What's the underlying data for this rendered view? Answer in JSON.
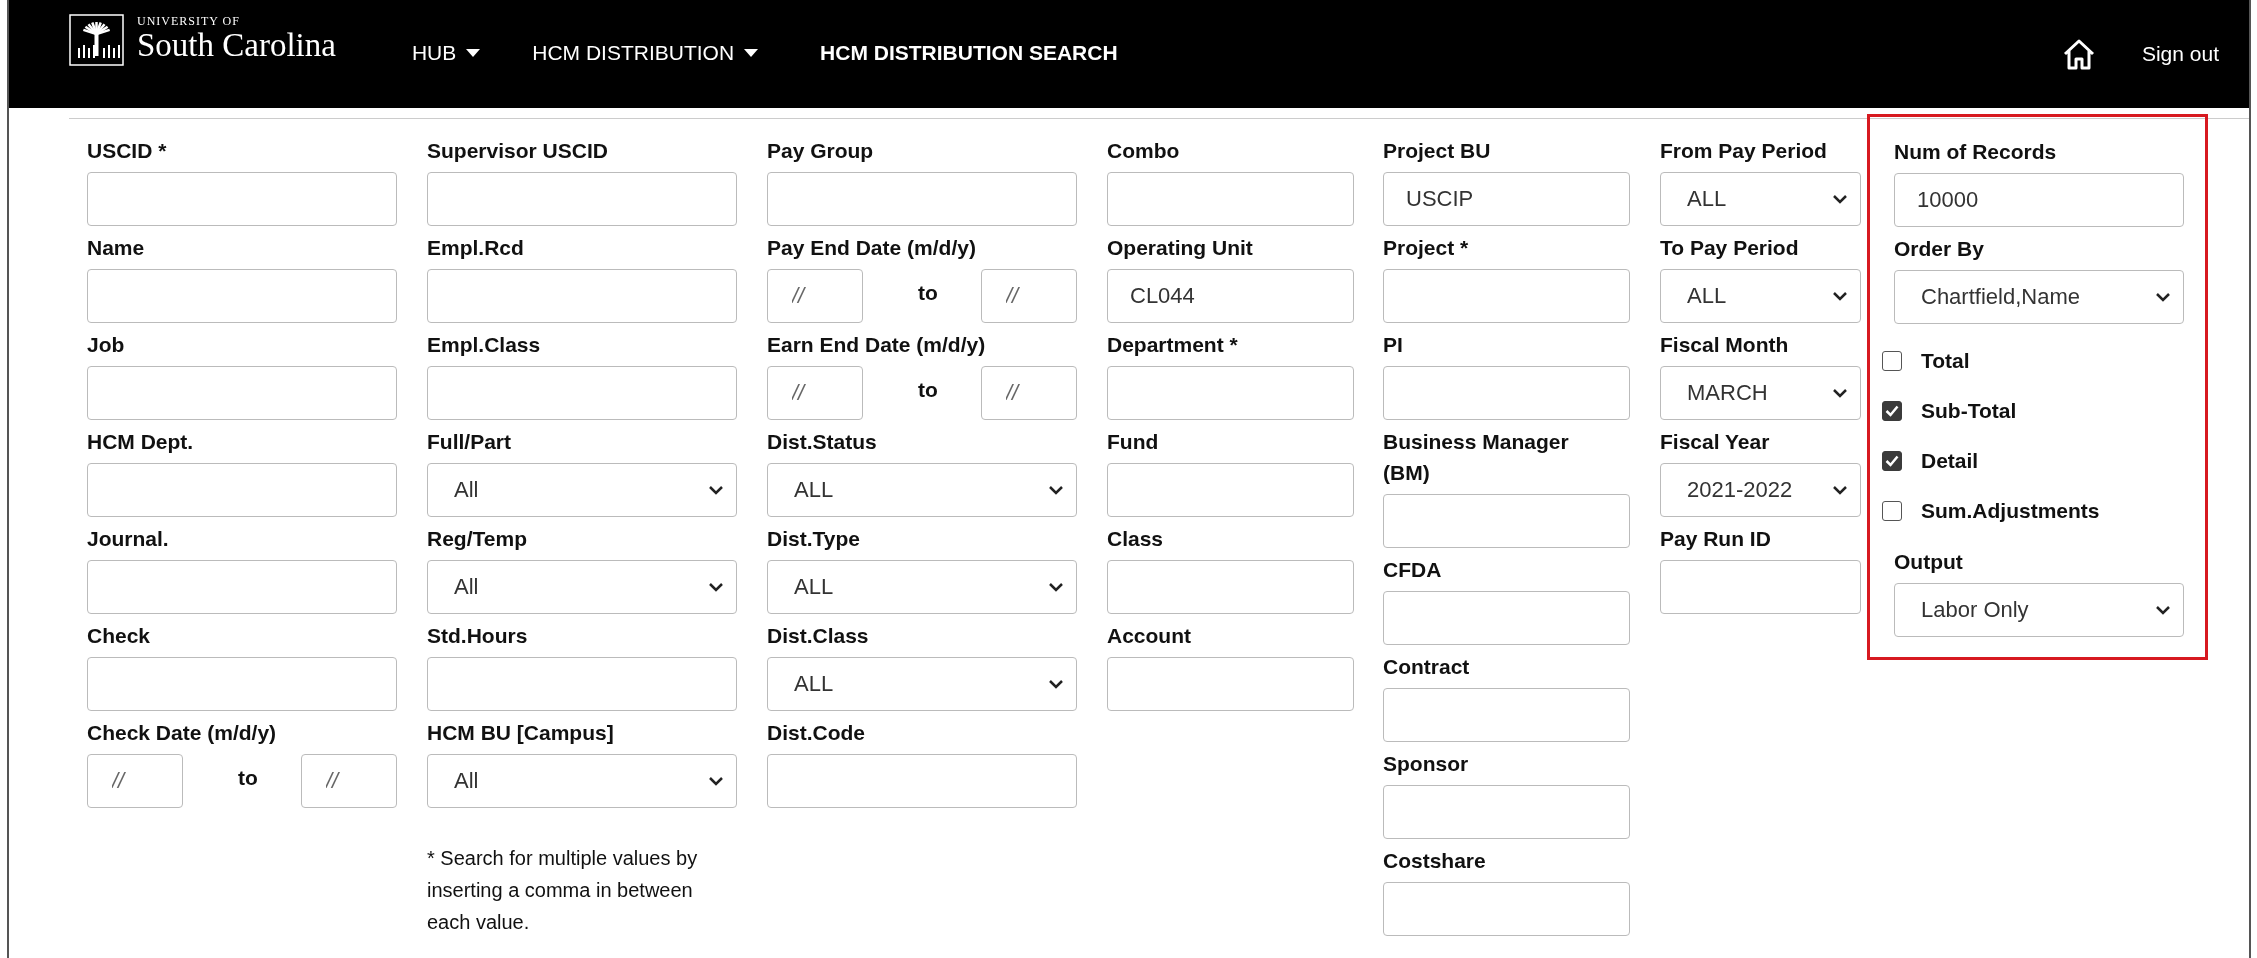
{
  "header": {
    "logo": {
      "line_1": "UNIVERSITY OF",
      "line_2": "South Carolina"
    },
    "nav": [
      {
        "label": "HUB",
        "kind": "dropdown",
        "selected": false
      },
      {
        "label": "HCM DISTRIBUTION",
        "kind": "dropdown",
        "selected": false
      },
      {
        "label": "HCM DISTRIBUTION SEARCH",
        "kind": "link",
        "selected": true
      }
    ],
    "sign_out": "Sign out"
  },
  "form": {
    "columns": [
      {
        "highlighted": false,
        "fields": [
          {
            "kind": "text",
            "label": "USCID *"
          },
          {
            "kind": "text",
            "label": "Name"
          },
          {
            "kind": "text",
            "label": "Job"
          },
          {
            "kind": "text",
            "label": "HCM Dept."
          },
          {
            "kind": "text",
            "label": "Journal."
          },
          {
            "kind": "text",
            "label": "Check"
          },
          {
            "kind": "date_range",
            "label": "Check Date (m/d/y)",
            "from_placeholder": "//",
            "joiner": "to",
            "to_placeholder": "//"
          }
        ]
      },
      {
        "highlighted": false,
        "fields": [
          {
            "kind": "text",
            "label": "Supervisor USCID"
          },
          {
            "kind": "text",
            "label": "Empl.Rcd"
          },
          {
            "kind": "text",
            "label": "Empl.Class"
          },
          {
            "kind": "select",
            "label": "Full/Part",
            "value": "All"
          },
          {
            "kind": "select",
            "label": "Reg/Temp",
            "value": "All"
          },
          {
            "kind": "text",
            "label": "Std.Hours"
          },
          {
            "kind": "select",
            "label": "HCM BU [Campus]",
            "value": "All"
          },
          {
            "kind": "note",
            "text": "* Search for multiple values by inserting a comma in between each value."
          }
        ]
      },
      {
        "highlighted": false,
        "fields": [
          {
            "kind": "text",
            "label": "Pay Group"
          },
          {
            "kind": "date_range",
            "label": "Pay End Date (m/d/y)",
            "from_placeholder": "//",
            "joiner": "to",
            "to_placeholder": "//"
          },
          {
            "kind": "date_range",
            "label": "Earn End Date (m/d/y)",
            "from_placeholder": "//",
            "joiner": "to",
            "to_placeholder": "//"
          },
          {
            "kind": "select",
            "label": "Dist.Status",
            "value": "ALL"
          },
          {
            "kind": "select",
            "label": "Dist.Type",
            "value": "ALL"
          },
          {
            "kind": "select",
            "label": "Dist.Class",
            "value": "ALL"
          },
          {
            "kind": "text",
            "label": "Dist.Code"
          }
        ]
      },
      {
        "highlighted": false,
        "fields": [
          {
            "kind": "text",
            "label": "Combo"
          },
          {
            "kind": "text",
            "label": "Operating Unit",
            "value": "CL044"
          },
          {
            "kind": "text",
            "label": "Department *"
          },
          {
            "kind": "text",
            "label": "Fund"
          },
          {
            "kind": "text",
            "label": "Class"
          },
          {
            "kind": "text",
            "label": "Account"
          }
        ]
      },
      {
        "highlighted": false,
        "fields": [
          {
            "kind": "text",
            "label": "Project BU",
            "value": "USCIP"
          },
          {
            "kind": "text",
            "label": "Project *"
          },
          {
            "kind": "text",
            "label": "PI"
          },
          {
            "kind": "text",
            "label": "Business Manager (BM)"
          },
          {
            "kind": "text",
            "label": "CFDA"
          },
          {
            "kind": "text",
            "label": "Contract"
          },
          {
            "kind": "text",
            "label": "Sponsor"
          },
          {
            "kind": "text",
            "label": "Costshare"
          }
        ]
      },
      {
        "highlighted": false,
        "fields": [
          {
            "kind": "select",
            "label": "From Pay Period",
            "value": "ALL"
          },
          {
            "kind": "select",
            "label": "To Pay Period",
            "value": "ALL"
          },
          {
            "kind": "select",
            "label": "Fiscal Month",
            "value": "MARCH"
          },
          {
            "kind": "select",
            "label": "Fiscal Year",
            "value": "2021-2022"
          },
          {
            "kind": "text",
            "label": "Pay Run ID"
          }
        ]
      },
      {
        "highlighted": true,
        "fields": [
          {
            "kind": "text",
            "label": "Num of Records",
            "value": "10000"
          },
          {
            "kind": "select",
            "label": "Order By",
            "value": "Chartfield,Name"
          },
          {
            "kind": "checkbox",
            "label": "Total",
            "checked": false
          },
          {
            "kind": "checkbox",
            "label": "Sub-Total",
            "checked": true
          },
          {
            "kind": "checkbox",
            "label": "Detail",
            "checked": true
          },
          {
            "kind": "checkbox",
            "label": "Sum.Adjustments",
            "checked": false
          },
          {
            "kind": "select",
            "label": "Output",
            "value": "Labor Only"
          }
        ]
      }
    ]
  }
}
